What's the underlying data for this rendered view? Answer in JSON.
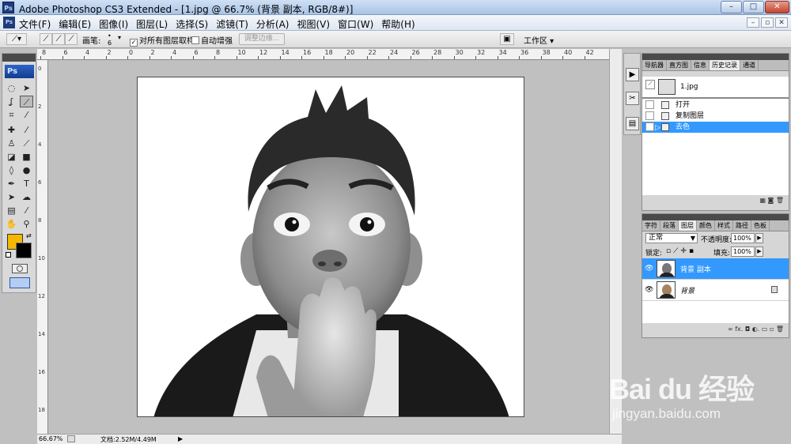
{
  "window": {
    "app_icon": "Ps",
    "title": "Adobe Photoshop CS3 Extended - [1.jpg @ 66.7% (背景 副本, RGB/8#)]",
    "min_symbol": "–",
    "max_symbol": "□",
    "close_symbol": "✕"
  },
  "menu": {
    "items": [
      "文件(F)",
      "编辑(E)",
      "图像(I)",
      "图层(L)",
      "选择(S)",
      "滤镜(T)",
      "分析(A)",
      "视图(V)",
      "窗口(W)",
      "帮助(H)"
    ],
    "doc_controls": [
      "–",
      "▫",
      "✕"
    ]
  },
  "options": {
    "brush_label": "画笔:",
    "brush_size": "6",
    "sample_all_layers": "对所有图层取样",
    "auto_enhance": "自动增强",
    "refine_edge": "调整边缘...",
    "workspace": "工作区 ▾"
  },
  "toolbox": {
    "logo": "Ps"
  },
  "rulers": {
    "top": [
      "8",
      "6",
      "4",
      "2",
      "0",
      "2",
      "4",
      "6",
      "8",
      "10",
      "12",
      "14",
      "16",
      "18",
      "20",
      "22",
      "24",
      "26",
      "28",
      "30",
      "32",
      "34",
      "36",
      "38",
      "40",
      "42"
    ]
  },
  "status": {
    "zoom": "66.67%",
    "doc_size": "文档:2.52M/4.49M"
  },
  "history_panel": {
    "tabs": [
      "导航器",
      "直方图",
      "信息",
      "历史记录",
      "通道"
    ],
    "active_tab": 3,
    "snapshot": "1.jpg",
    "steps": [
      "打开",
      "复制图层",
      "去色"
    ],
    "selected_step": 2,
    "footer_icons": "▦  ◙  🗑"
  },
  "layers_panel": {
    "tabs": [
      "字符",
      "段落",
      "图层",
      "颜色",
      "样式",
      "路径",
      "色板"
    ],
    "active_tab": 2,
    "blend_mode": "正常",
    "opacity_label": "不透明度:",
    "opacity_value": "100%",
    "lock_label": "锁定:",
    "fill_label": "填充:",
    "fill_value": "100%",
    "layers": [
      {
        "name": "背景 副本",
        "selected": true
      },
      {
        "name": "背景",
        "selected": false
      }
    ],
    "footer_icons": "∞  fx.  ◘  ◐.  ▭  ▫  🗑"
  },
  "watermark": {
    "brand": "Bai du 经验",
    "url": "jingyan.baidu.com"
  }
}
